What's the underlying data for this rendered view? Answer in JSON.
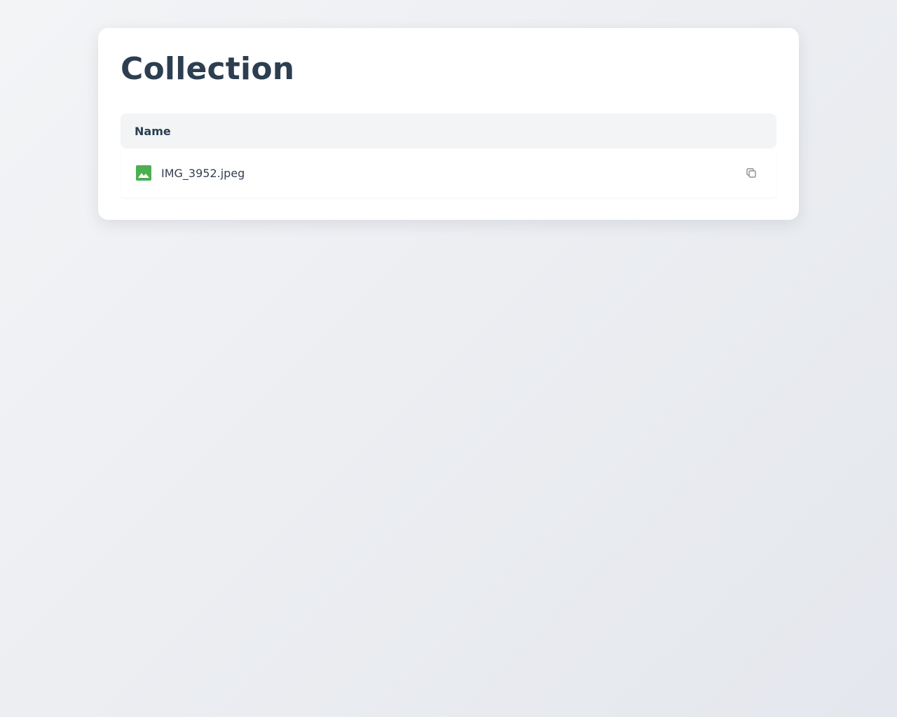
{
  "page": {
    "title": "Collection"
  },
  "table": {
    "columns": [
      {
        "label": "Name"
      }
    ],
    "rows": [
      {
        "name": "IMG_3952.jpeg",
        "icon": "image-icon",
        "action_icon": "copy-icon"
      }
    ]
  },
  "colors": {
    "image_icon": "#4caf50",
    "copy_icon": "#8a8f98"
  }
}
